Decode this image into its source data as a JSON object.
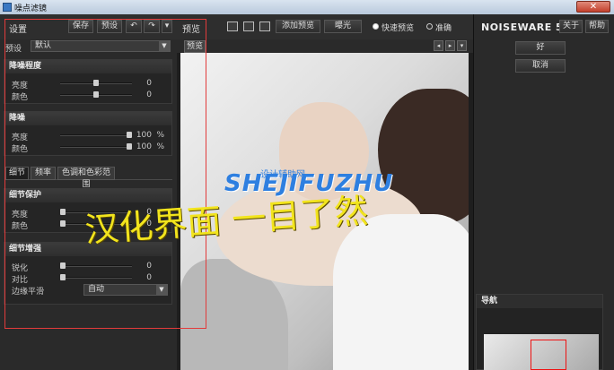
{
  "window": {
    "title": "噪点滤镜"
  },
  "left": {
    "settings_label": "设置",
    "save_label": "保存",
    "preset_btn_label": "预设",
    "undo_glyph": "↶",
    "redo_glyph": "↷",
    "menu_glyph": "▾",
    "preset_label": "预设",
    "preset_value": "默认",
    "noise_level": {
      "title": "降噪程度",
      "rows": [
        {
          "label": "亮度",
          "value": "0",
          "pos": 0.5
        },
        {
          "label": "颜色",
          "value": "0",
          "pos": 0.5
        }
      ]
    },
    "noise_reduction": {
      "title": "降噪",
      "rows": [
        {
          "label": "亮度",
          "value": "100",
          "unit": "%",
          "pos": 1.0
        },
        {
          "label": "颜色",
          "value": "100",
          "unit": "%",
          "pos": 1.0
        }
      ]
    },
    "tabs": [
      "细节",
      "频率",
      "色调和色彩范围"
    ],
    "detail_protect": {
      "title": "细节保护",
      "rows": [
        {
          "label": "亮度",
          "value": "0",
          "pos": 0.0
        },
        {
          "label": "颜色",
          "value": "0",
          "pos": 0.0
        }
      ]
    },
    "detail_enhance": {
      "title": "细节增强",
      "rows": [
        {
          "label": "锐化",
          "value": "0",
          "pos": 0.0
        },
        {
          "label": "对比",
          "value": "0",
          "pos": 0.0
        }
      ],
      "edge_label": "边缘平滑",
      "edge_value": "自动"
    }
  },
  "preview": {
    "label": "预览",
    "add_preview": "添加预览",
    "exposure": "曝光",
    "fast_preview": "快速预览",
    "accurate": "准确",
    "tab": "预览",
    "prev_glyph": "◂",
    "next_glyph": "▸",
    "down_glyph": "▾"
  },
  "right": {
    "brand": "NOISEWARE 5",
    "about": "关于",
    "help": "帮助",
    "ok": "好",
    "cancel": "取消",
    "nav_title": "导航"
  },
  "overlay": {
    "caption": "汉化界面  一目了然",
    "watermark": "SHEJIFUZHU",
    "watermark_small": "设计辅助网"
  },
  "colors": {
    "highlight": "#e23b3b",
    "caption": "#f2e41d",
    "watermark": "#2e7fe0"
  }
}
